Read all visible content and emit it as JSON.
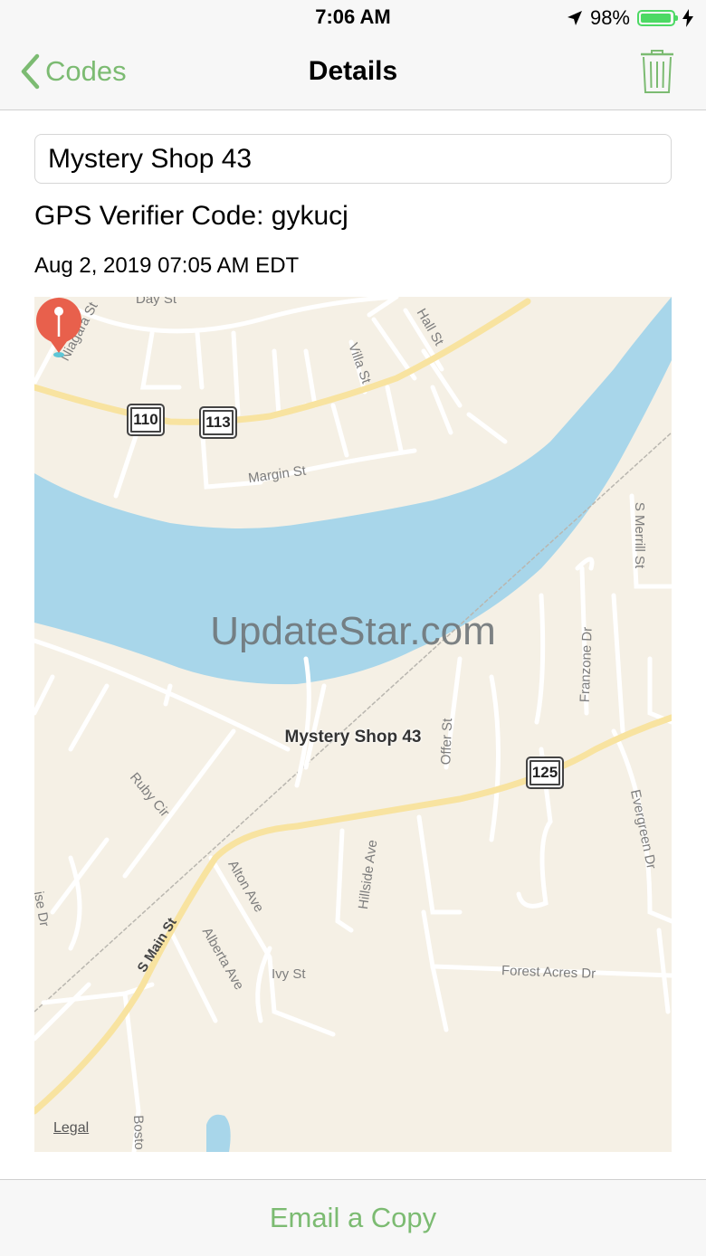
{
  "status_bar": {
    "time": "7:06 AM",
    "battery": "98%",
    "battery_level": 0.98
  },
  "nav": {
    "back_label": "Codes",
    "title": "Details"
  },
  "form": {
    "name_value": "Mystery Shop 43",
    "code": "GPS Verifier Code: gykucj",
    "date": "Aug 2, 2019 07:05 AM EDT"
  },
  "map": {
    "watermark": "UpdateStar.com",
    "pin_label": "Mystery Shop 43",
    "legal": "Legal",
    "streets": [
      "Day St",
      "Niagara St",
      "Hall St",
      "Villa St",
      "Margin St",
      "S Merrill St",
      "Franzone Dr",
      "Offer St",
      "Ruby Cir",
      "Evergreen Dr",
      "Alton Ave",
      "Hillside Ave",
      "S Main St",
      "Alberta Ave",
      "Ivy St",
      "Forest Acres Dr",
      "ise Dr",
      "Bosto"
    ],
    "shields": [
      "110",
      "113",
      "125"
    ],
    "colors": {
      "water": "#a8d6ea",
      "land": "#f5f0e5",
      "road": "#f8e3a0",
      "street": "#ffffff",
      "pin": "#e8604c"
    }
  },
  "bottom": {
    "email_label": "Email a Copy"
  },
  "colors": {
    "accent": "#7cbb72"
  }
}
